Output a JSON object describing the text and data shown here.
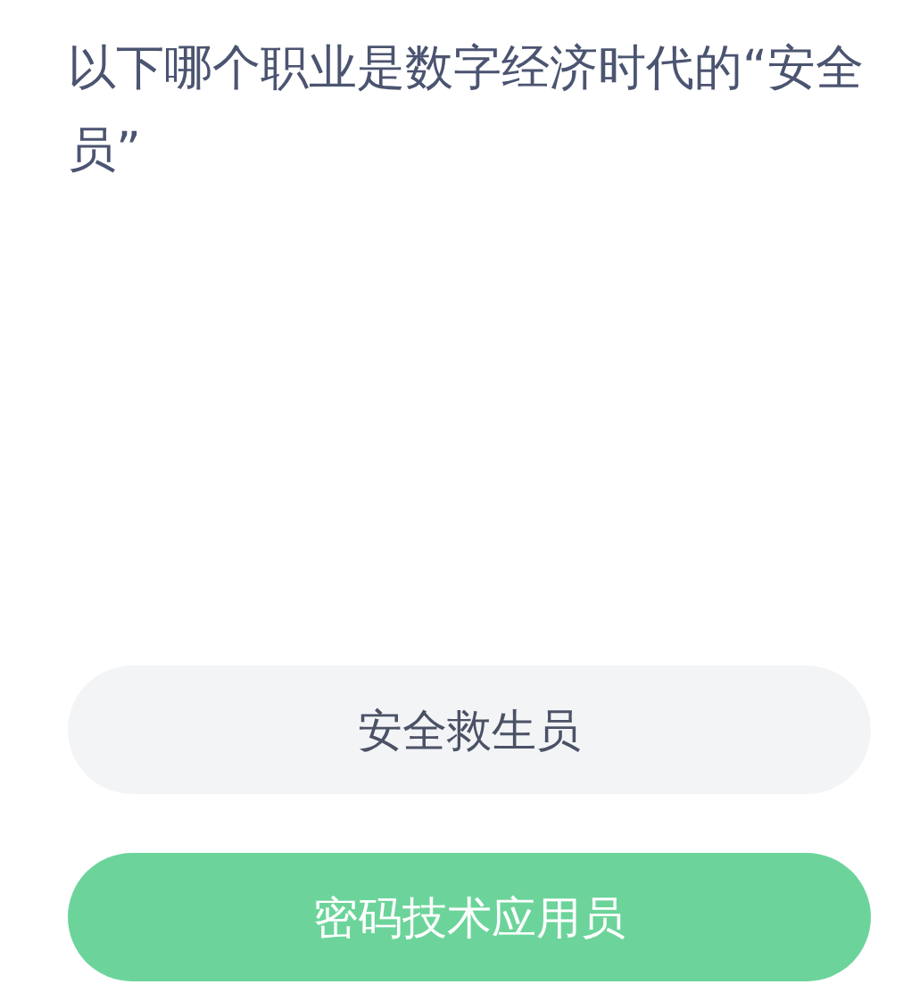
{
  "question": "以下哪个职业是数字经济时代的“安全员”",
  "options": [
    {
      "label": "安全救生员",
      "selected": false
    },
    {
      "label": "密码技术应用员",
      "selected": true
    }
  ]
}
